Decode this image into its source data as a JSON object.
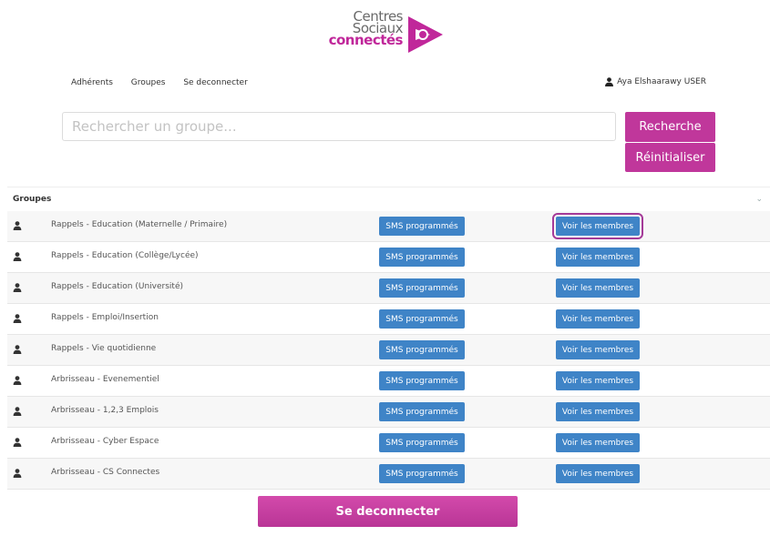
{
  "logo": {
    "line1": "Centres",
    "line2": "Sociaux",
    "line3": "connectés"
  },
  "nav": {
    "items": [
      "Adhérents",
      "Groupes",
      "Se deconnecter"
    ]
  },
  "user": {
    "name": "Aya Elshaarawy USER",
    "icon": "user-icon"
  },
  "search": {
    "placeholder": "Rechercher un groupe...",
    "value": "",
    "search_label": "Recherche",
    "reset_label": "Réinitialiser"
  },
  "panel": {
    "title": "Groupes",
    "toggle_icon": "chevron-down-icon"
  },
  "rows": [
    {
      "name": "Rappels - Education (Maternelle / Primaire)",
      "sms_label": "SMS programmés",
      "members_label": "Voir les membres",
      "focused": true
    },
    {
      "name": "Rappels - Education (Collège/Lycée)",
      "sms_label": "SMS programmés",
      "members_label": "Voir les membres"
    },
    {
      "name": "Rappels - Education (Université)",
      "sms_label": "SMS programmés",
      "members_label": "Voir les membres"
    },
    {
      "name": "Rappels - Emploi/Insertion",
      "sms_label": "SMS programmés",
      "members_label": "Voir les membres"
    },
    {
      "name": "Rappels - Vie quotidienne",
      "sms_label": "SMS programmés",
      "members_label": "Voir les membres"
    },
    {
      "name": "Arbrisseau - Evenementiel",
      "sms_label": "SMS programmés",
      "members_label": "Voir les membres"
    },
    {
      "name": "Arbrisseau - 1,2,3 Emplois",
      "sms_label": "SMS programmés",
      "members_label": "Voir les membres"
    },
    {
      "name": "Arbrisseau - Cyber Espace",
      "sms_label": "SMS programmés",
      "members_label": "Voir les membres"
    },
    {
      "name": "Arbrisseau - CS Connectes",
      "sms_label": "SMS programmés",
      "members_label": "Voir les membres"
    }
  ],
  "footer": {
    "logout_label": "Se deconnecter"
  },
  "colors": {
    "brand_pink": "#c0379b",
    "button_blue": "#3f84c7",
    "focus_outline": "#a53a98"
  }
}
